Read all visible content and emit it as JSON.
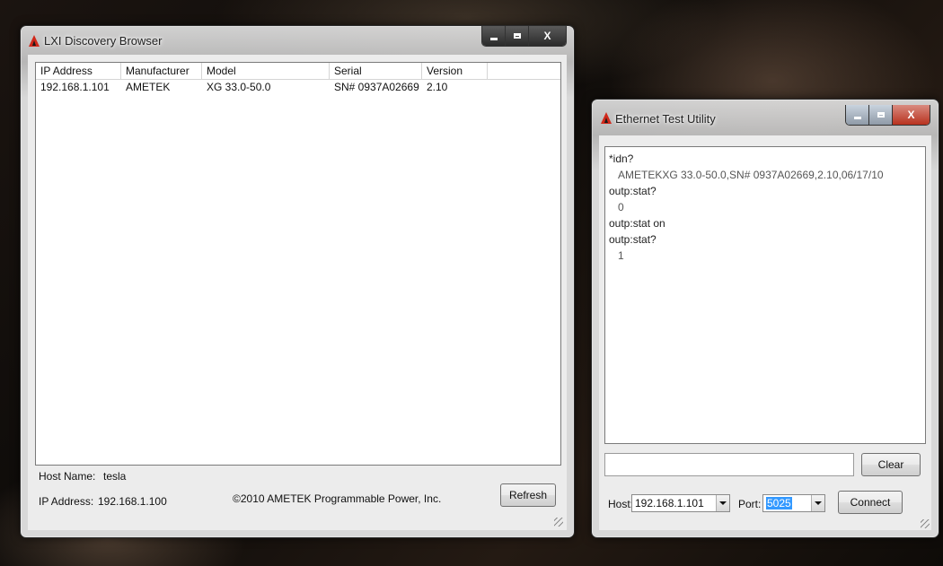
{
  "lxi": {
    "title": "LXI Discovery Browser",
    "columns": [
      "IP Address",
      "Manufacturer",
      "Model",
      "Serial",
      "Version"
    ],
    "rows": [
      {
        "ip": "192.168.1.101",
        "manufacturer": "AMETEK",
        "model": "XG 33.0-50.0",
        "serial": "SN# 0937A02669",
        "version": "2.10"
      }
    ],
    "host_name_label": "Host Name:",
    "host_name_value": "tesla",
    "ip_address_label": "IP Address:",
    "ip_address_value": "192.168.1.100",
    "copyright": "©2010 AMETEK Programmable Power, Inc.",
    "refresh_label": "Refresh",
    "caption_close": "X"
  },
  "ethernet": {
    "title": "Ethernet Test Utility",
    "console_lines": [
      "*idn?",
      "AMETEKXG 33.0-50.0,SN# 0937A02669,2.10,06/17/10",
      "outp:stat?",
      "0",
      "outp:stat on",
      "outp:stat?",
      "1"
    ],
    "command_value": "",
    "clear_label": "Clear",
    "host_label": "Host:",
    "host_value": "192.168.1.101",
    "port_label": "Port:",
    "port_value": "5025",
    "connect_label": "Connect",
    "caption_close": "X"
  },
  "colors": {
    "app_icon": "#d1281a",
    "selection": "#3399ff",
    "close_button": "#b8321e"
  },
  "icons": [
    "ametek-logo-icon",
    "minimize-icon",
    "maximize-icon",
    "close-icon",
    "dropdown-arrow-icon",
    "resize-grip-icon"
  ]
}
